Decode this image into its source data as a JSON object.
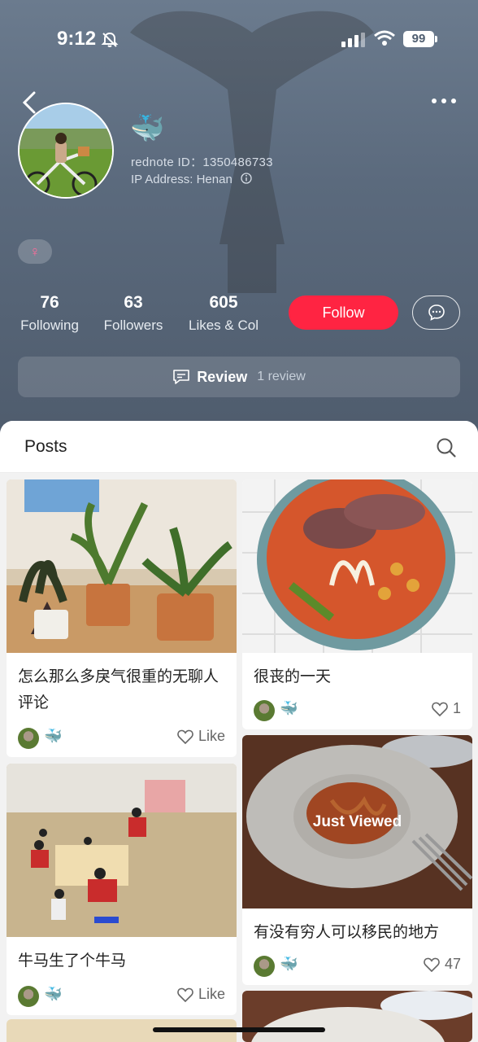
{
  "status_bar": {
    "time": "9:12",
    "battery": "99"
  },
  "profile": {
    "nickname_icon": "🐳",
    "rednote_id": "rednote ID：1350486733",
    "ip_address": "IP Address: Henan",
    "gender_symbol": "♀"
  },
  "stats": [
    {
      "value": "76",
      "label": "Following"
    },
    {
      "value": "63",
      "label": "Followers"
    },
    {
      "value": "605",
      "label": "Likes & Col"
    }
  ],
  "actions": {
    "follow_label": "Follow"
  },
  "review": {
    "label": "Review",
    "count": "1 review"
  },
  "tabs": {
    "posts_label": "Posts"
  },
  "posts_left": [
    {
      "title": "怎么那么多戾气很重的无聊人评论",
      "author": "🐳",
      "likes": "Like"
    },
    {
      "title": "牛马生了个牛马",
      "author": "🐳",
      "likes": "Like"
    }
  ],
  "posts_right": [
    {
      "title": "很丧的一天",
      "author": "🐳",
      "likes": "1"
    },
    {
      "title": "有没有穷人可以移民的地方",
      "author": "🐳",
      "likes": "47",
      "badge": "Just Viewed"
    }
  ],
  "colors": {
    "accent": "#ff2442",
    "header": "#5b6a7d"
  }
}
